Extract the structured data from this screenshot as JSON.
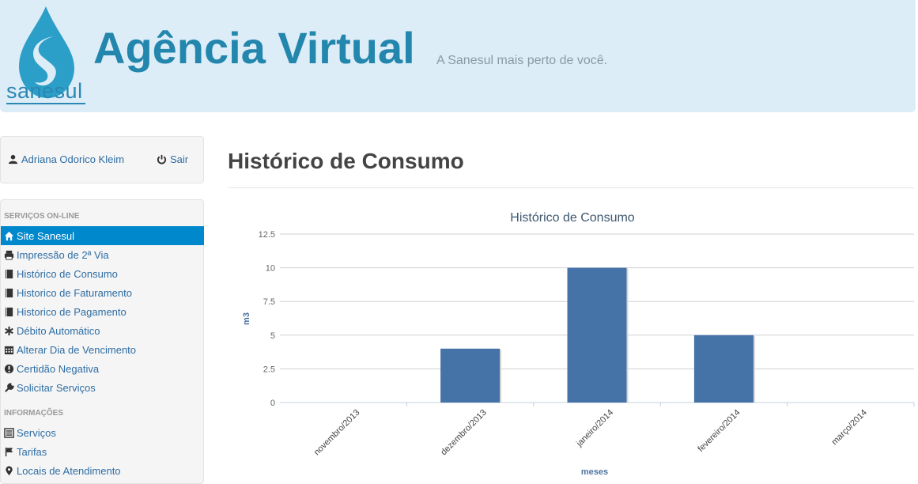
{
  "header": {
    "logo_text": "sanesul",
    "title": "Agência Virtual",
    "tagline": "A Sanesul mais perto de você."
  },
  "user": {
    "name": "Adriana Odorico Kleim",
    "logout_label": "Sair"
  },
  "nav": {
    "section_services": "SERVIÇOS ON-LINE",
    "section_info": "INFORMAÇÕES",
    "items": [
      {
        "label": "Site Sanesul",
        "icon": "home-icon",
        "active": true
      },
      {
        "label": "Impressão de 2ª Via",
        "icon": "print-icon"
      },
      {
        "label": "Histórico de Consumo",
        "icon": "book-icon"
      },
      {
        "label": "Historico de Faturamento",
        "icon": "book-icon"
      },
      {
        "label": "Historico de Pagamento",
        "icon": "book-icon"
      },
      {
        "label": "Débito Automático",
        "icon": "asterisk-icon"
      },
      {
        "label": "Alterar Dia de Vencimento",
        "icon": "calendar-icon"
      },
      {
        "label": "Certidão Negativa",
        "icon": "exclamation-icon"
      },
      {
        "label": "Solicitar Serviços",
        "icon": "wrench-icon"
      }
    ],
    "info_items": [
      {
        "label": "Serviços",
        "icon": "list-icon"
      },
      {
        "label": "Tarifas",
        "icon": "flag-icon"
      },
      {
        "label": "Locais de Atendimento",
        "icon": "map-marker-icon"
      }
    ]
  },
  "main": {
    "page_title": "Histórico de Consumo"
  },
  "chart_data": {
    "type": "bar",
    "title": "Histórico de Consumo",
    "xlabel": "meses",
    "ylabel": "m3",
    "categories": [
      "novembro/2013",
      "dezembro/2013",
      "janeiro/2014",
      "fevereiro/2014",
      "março/2014"
    ],
    "values": [
      0,
      4,
      10,
      5,
      0
    ],
    "ylim": [
      0,
      12.5
    ],
    "yticks": [
      "0",
      "2.5",
      "5",
      "7.5",
      "10",
      "12.5"
    ],
    "grid": true,
    "bar_color": "#4572a7"
  }
}
